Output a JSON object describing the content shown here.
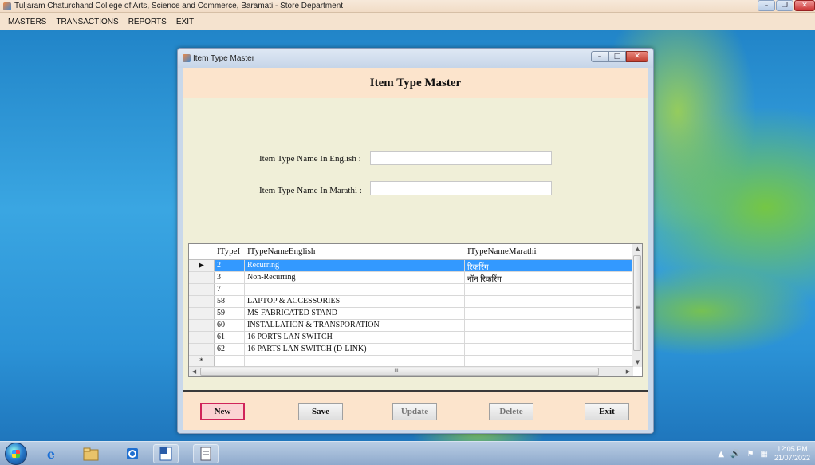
{
  "app": {
    "title": "Tuljaram Chaturchand College of Arts, Science and Commerce, Baramati - Store Department",
    "controls": {
      "minimize": "–",
      "maximize": "❐",
      "close": "✕"
    }
  },
  "menubar": {
    "items": [
      "MASTERS",
      "TRANSACTIONS",
      "REPORTS",
      "EXIT"
    ]
  },
  "window": {
    "title": "Item Type Master",
    "controls": {
      "minimize": "–",
      "maximize": "□",
      "close": "✕"
    }
  },
  "form": {
    "title": "Item Type Master",
    "english_label": "Item Type Name In English :",
    "english_value": "",
    "marathi_label": "Item Type Name In Marathi :",
    "marathi_value": ""
  },
  "grid": {
    "headers": [
      "ITypeI",
      "ITypeNameEnglish",
      "ITypeNameMarathi"
    ],
    "rows": [
      {
        "marker": "▶",
        "id": "2",
        "english": "Recurring",
        "marathi": "रिकरिंग",
        "selected": true
      },
      {
        "marker": "",
        "id": "3",
        "english": "Non-Recurring",
        "marathi": "नॉन रिकरिंग",
        "selected": false
      },
      {
        "marker": "",
        "id": "7",
        "english": "",
        "marathi": "",
        "selected": false
      },
      {
        "marker": "",
        "id": "58",
        "english": "LAPTOP & ACCESSORIES",
        "marathi": "",
        "selected": false
      },
      {
        "marker": "",
        "id": "59",
        "english": "MS FABRICATED STAND",
        "marathi": "",
        "selected": false
      },
      {
        "marker": "",
        "id": "60",
        "english": "INSTALLATION & TRANSPORATION",
        "marathi": "",
        "selected": false
      },
      {
        "marker": "",
        "id": "61",
        "english": "16 PORTS LAN SWITCH",
        "marathi": "",
        "selected": false
      },
      {
        "marker": "",
        "id": "62",
        "english": "16 PARTS LAN SWITCH (D-LINK)",
        "marathi": "",
        "selected": false
      },
      {
        "marker": "*",
        "id": "",
        "english": "",
        "marathi": "",
        "selected": false
      }
    ],
    "scroll_glyphs": {
      "up": "▲",
      "down": "▼",
      "left": "◀",
      "right": "▶",
      "grip_v": "≡",
      "grip_h": "III"
    }
  },
  "buttons": {
    "new": "New",
    "save": "Save",
    "update": "Update",
    "delete": "Delete",
    "exit": "Exit"
  },
  "taskbar": {
    "tray": {
      "up": "▲",
      "volume": "🔊",
      "flag": "⚑",
      "network": "▦"
    },
    "clock_time": "12:05 PM",
    "clock_date": "21/07/2022"
  }
}
